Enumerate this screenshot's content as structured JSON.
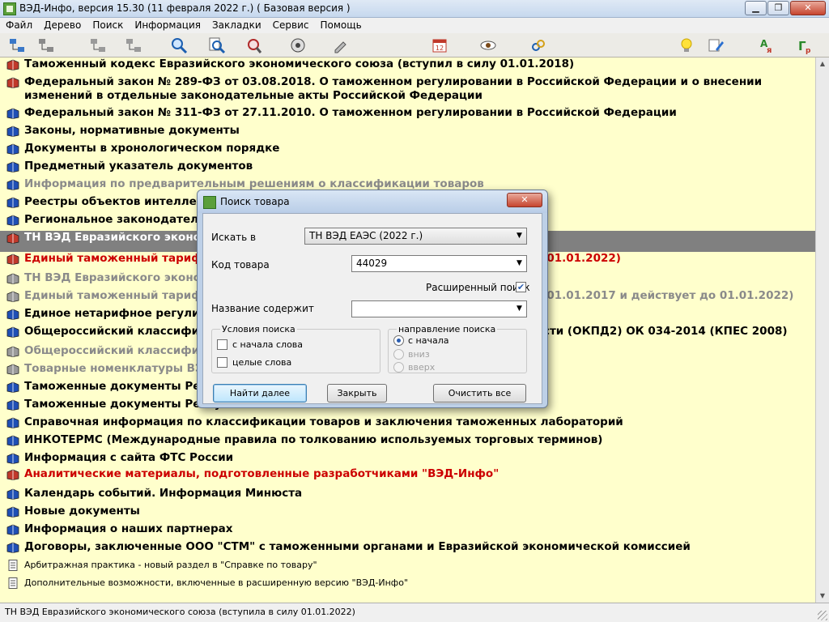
{
  "window": {
    "title": "ВЭД-Инфо, версия 15.30 (11 февраля 2022 г.)  ( Базовая версия )",
    "minimize": "▁",
    "maximize": "❐",
    "close": "✕"
  },
  "menu": [
    "Файл",
    "Дерево",
    "Поиск",
    "Информация",
    "Закладки",
    "Сервис",
    "Помощь"
  ],
  "toolbar": [
    {
      "name": "tree-expand-icon"
    },
    {
      "name": "tree-collapse-icon"
    },
    {
      "name": "tree-nav-icon"
    },
    {
      "name": "tree-levels-icon"
    },
    {
      "name": "search-icon"
    },
    {
      "name": "search-document-icon"
    },
    {
      "name": "search-special-icon"
    },
    {
      "name": "audio-icon"
    },
    {
      "name": "edit-icon"
    },
    {
      "name": "calendar-icon",
      "label": "12"
    },
    {
      "name": "view-eye-icon"
    },
    {
      "name": "link-icon"
    },
    {
      "name": "lightbulb-icon"
    },
    {
      "name": "notes-icon"
    },
    {
      "name": "abc-icon"
    },
    {
      "name": "gr-icon"
    }
  ],
  "tree": [
    {
      "text": "Таможенный кодекс Евразийского экономического союза (вступил в силу 01.01.2018)",
      "icon": "red",
      "color": "#000000"
    },
    {
      "text": "Федеральный закон № 289-ФЗ от 03.08.2018. О таможенном регулировании в Российской Федерации и о внесении изменений в отдельные законодательные акты Российской Федерации",
      "icon": "red",
      "color": "#000000"
    },
    {
      "text": "Федеральный закон № 311-ФЗ от 27.11.2010. О таможенном регулировании в Российской Федерации",
      "icon": "blue",
      "color": "#000000"
    },
    {
      "text": "Законы, нормативные документы",
      "icon": "blue",
      "color": "#000000"
    },
    {
      "text": "Документы в хронологическом порядке",
      "icon": "blue",
      "color": "#000000"
    },
    {
      "text": "Предметный указатель документов",
      "icon": "blue",
      "color": "#000000"
    },
    {
      "text": "Информация по предварительным решениям о классификации товаров",
      "icon": "blue",
      "color": "#8a8a8a"
    },
    {
      "text": "Реестры объектов интеллектуальной собственности",
      "icon": "blue",
      "color": "#000000"
    },
    {
      "text": "Региональное законодательство",
      "icon": "blue",
      "color": "#000000"
    },
    {
      "text": "ТН ВЭД Евразийского экономического союза (вступила в силу 01.01.2022)",
      "icon": "red",
      "color": "#ffffff",
      "selected": true
    },
    {
      "text": "Единый таможенный тариф Евразийского экономического союза (вступил в силу 01.01.2022)",
      "icon": "red",
      "color": "#cc0000"
    },
    {
      "text": "ТН ВЭД Евразийского экономического союза",
      "icon": "gray",
      "color": "#8a8a8a"
    },
    {
      "text": "Единый таможенный тариф Евразийского экономического союза (вступил в силу 01.01.2017 и действует до 01.01.2022)",
      "icon": "gray",
      "color": "#8a8a8a"
    },
    {
      "text": "Единое нетарифное регулирование",
      "icon": "blue",
      "color": "#000000"
    },
    {
      "text": "Общероссийский классификатор продукции по видам экономической деятельности (ОКПД2) ОК 034-2014 (КПЕС 2008)",
      "icon": "blue",
      "color": "#000000"
    },
    {
      "text": "Общероссийский классификатор",
      "icon": "gray",
      "color": "#8a8a8a"
    },
    {
      "text": "Товарные номенклатуры ВЭД",
      "icon": "gray",
      "color": "#8a8a8a"
    },
    {
      "text": "Таможенные документы Республики",
      "icon": "blue",
      "color": "#000000"
    },
    {
      "text": "Таможенные документы Республики Казахстан",
      "icon": "blue",
      "color": "#000000"
    },
    {
      "text": "Справочная информация по классификации товаров и заключения таможенных лабораторий",
      "icon": "blue",
      "color": "#000000"
    },
    {
      "text": "ИНКОТЕРМС (Международные правила по толкованию используемых торговых терминов)",
      "icon": "blue",
      "color": "#000000"
    },
    {
      "text": "Информация с сайта ФТС России",
      "icon": "blue",
      "color": "#000000"
    },
    {
      "text": "Аналитические материалы, подготовленные разработчиками \"ВЭД-Инфо\"",
      "icon": "red",
      "color": "#cc0000"
    },
    {
      "text": "Календарь событий. Информация Минюста",
      "icon": "blue",
      "color": "#000000"
    },
    {
      "text": "Новые документы",
      "icon": "blue",
      "color": "#000000"
    },
    {
      "text": "Информация о наших партнерах",
      "icon": "blue",
      "color": "#000000"
    },
    {
      "text": "Договоры, заключенные ООО \"СТМ\" с таможенными органами и Евразийской экономической комиссией",
      "icon": "blue",
      "color": "#000000"
    },
    {
      "text": "Арбитражная практика - новый раздел в \"Справке по товару\"",
      "icon": "doc",
      "color": "#000000",
      "small": true
    },
    {
      "text": "Дополнительные возможности, включенные в расширенную версию \"ВЭД-Инфо\"",
      "icon": "doc",
      "color": "#000000",
      "small": true
    }
  ],
  "status": "ТН ВЭД Евразийского экономического союза (вступила в силу 01.01.2022)",
  "dialog": {
    "title": "Поиск товара",
    "search_in_label": "Искать в",
    "search_in_value": "ТН ВЭД ЕАЭС (2022 г.)",
    "code_label": "Код товара",
    "code_value": "44029",
    "extended_label": "Расширенный поиск",
    "extended_checked": true,
    "name_label": "Название содержит",
    "name_value": "",
    "conditions_title": "Условия поиска",
    "cond_from_start": "с начала слова",
    "cond_whole": "целые слова",
    "direction_title": "направление поиска",
    "dir_from_start": "с начала",
    "dir_down": "вниз",
    "dir_up": "вверх",
    "find_next_button": "Найти далее",
    "close_button": "Закрыть",
    "clear_button": "Очистить все"
  }
}
